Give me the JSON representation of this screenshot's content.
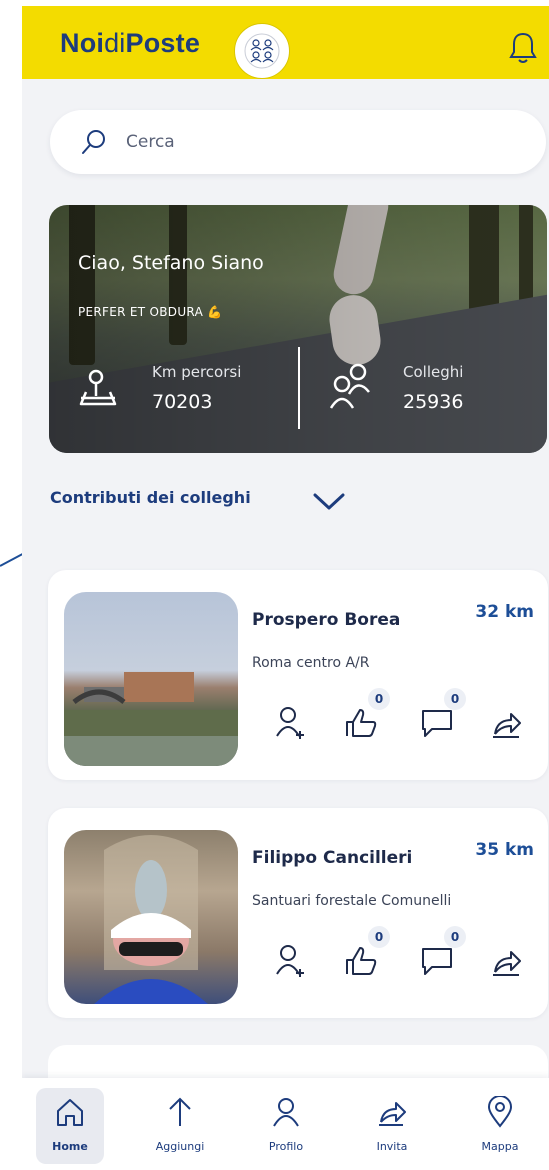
{
  "header": {
    "logo": {
      "part1": "Noi",
      "part2": "di",
      "part3": "Poste"
    }
  },
  "search": {
    "placeholder": "Cerca"
  },
  "hero": {
    "greeting": "Ciao, Stefano Siano",
    "motto": "PERFER ET OBDURA",
    "km_label": "Km percorsi",
    "km_value": "70203",
    "colleagues_label": "Colleghi",
    "colleagues_value": "25936"
  },
  "section": {
    "title": "Contributi dei colleghi"
  },
  "feed": [
    {
      "name": "Prospero Borea",
      "distance": "32 km",
      "route": "Roma centro A/R",
      "likes": "0",
      "comments": "0"
    },
    {
      "name": "Filippo Cancilleri",
      "distance": "35 km",
      "route": "Santuari forestale Comunelli",
      "likes": "0",
      "comments": "0"
    }
  ],
  "nav": [
    {
      "label": "Home",
      "icon": "home-icon",
      "active": true
    },
    {
      "label": "Aggiungi",
      "icon": "arrow-up-icon"
    },
    {
      "label": "Profilo",
      "icon": "user-icon"
    },
    {
      "label": "Invita",
      "icon": "share-icon"
    },
    {
      "label": "Mappa",
      "icon": "map-pin-icon"
    }
  ],
  "colors": {
    "header_yellow": "#f3dc00",
    "brand_blue": "#1d3c7d",
    "accent_blue": "#1d4e97",
    "background": "#f2f3f6"
  }
}
